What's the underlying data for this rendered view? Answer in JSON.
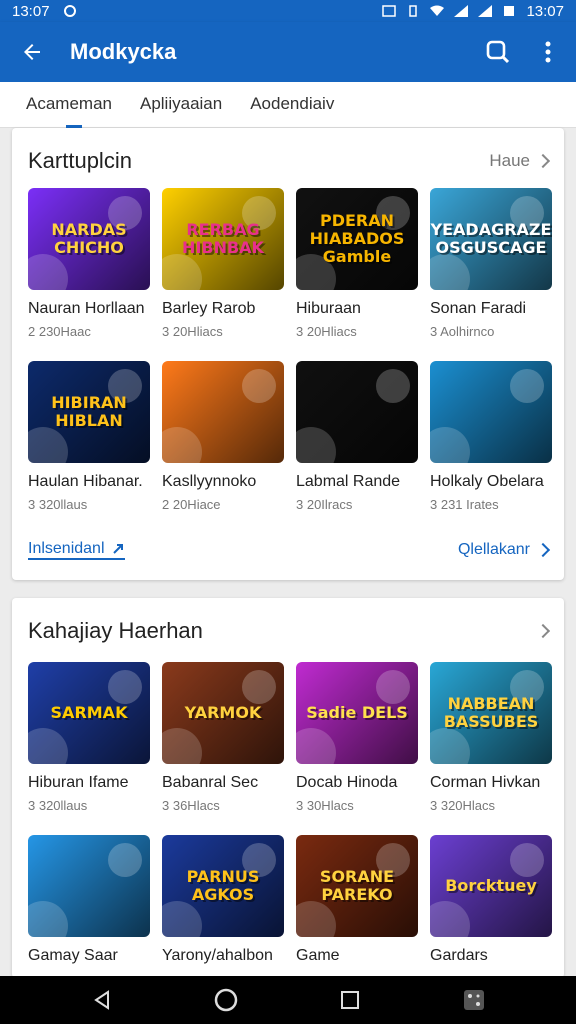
{
  "status": {
    "time_left": "13:07",
    "time_right": "13:07"
  },
  "appbar": {
    "title": "Modkycka",
    "back_icon": "arrow-left-icon",
    "search_icon": "search-icon",
    "menu_icon": "more-vert-icon"
  },
  "tabs": [
    "Acameman",
    "Apliiyaaian",
    "Aodendiaiv"
  ],
  "section1": {
    "title": "Karttuplcin",
    "more": "Haue",
    "items": [
      {
        "name": "Nauran Horllaan",
        "sub": "2 230Haac",
        "art": "NARDAS CHICHO",
        "bg": "#7b2ff7",
        "fg": "#ffd23f"
      },
      {
        "name": "Barley Rarob",
        "sub": "3 20Hliacs",
        "art": "RERBAG HIBNBAK",
        "bg": "#ffd000",
        "fg": "#e8308c"
      },
      {
        "name": "Hiburaan",
        "sub": "3 20Hliacs",
        "art": "PDERAN HIABADOS Gamble",
        "bg": "#111111",
        "fg": "#f7b500"
      },
      {
        "name": "Sonan Faradi",
        "sub": "3 Aolhirnco",
        "art": "YEADAGRAZE OSGUSCAGE",
        "bg": "#3aa6d8",
        "fg": "#ffffff"
      },
      {
        "name": "Haulan Hibanar.",
        "sub": "3 320llaus",
        "art": "HIBIRAN HIBLAN",
        "bg": "#0d2a6b",
        "fg": "#ffc21a"
      },
      {
        "name": "Kasllyynnoko",
        "sub": "2 20Hiace",
        "art": "",
        "bg": "#ff7a1a",
        "fg": "#ffffff"
      },
      {
        "name": "Labmal Rande",
        "sub": "3 20Ilracs",
        "art": "",
        "bg": "#101010",
        "fg": "#ffffff"
      },
      {
        "name": "Holkaly Obelara",
        "sub": "3 231 Irates",
        "art": "",
        "bg": "#1b8fd1",
        "fg": "#ffffff"
      }
    ],
    "footer_left": "Inlsenidanl",
    "footer_right": "Qlellakanr"
  },
  "section2": {
    "title": "Kahajiay Haerhan",
    "items": [
      {
        "name": "Hiburan Ifame",
        "sub": "3 320llaus",
        "art": "SARMAK",
        "bg": "#1f3fa8",
        "fg": "#ffcc00"
      },
      {
        "name": "Babanral Sec",
        "sub": "3 36Hlacs",
        "art": "YARMOK",
        "bg": "#8a3a1c",
        "fg": "#ffd23f"
      },
      {
        "name": "Docab Hinoda",
        "sub": "3 30Hlacs",
        "art": "Sadie DELS",
        "bg": "#c02bd1",
        "fg": "#ffe14d"
      },
      {
        "name": "Corman Hivkan",
        "sub": "3 320Hlacs",
        "art": "NABBEAN BASSUBES",
        "bg": "#29a7d6",
        "fg": "#ffd23f"
      },
      {
        "name": "Gamay Saar",
        "sub": "",
        "art": "",
        "bg": "#2596e6",
        "fg": "#ffffff"
      },
      {
        "name": "Yarony/ahalbon",
        "sub": "",
        "art": "PARNUS AGKOS",
        "bg": "#1b3a9c",
        "fg": "#ffc21a"
      },
      {
        "name": "Game",
        "sub": "",
        "art": "SORANE PAREKO",
        "bg": "#7a2a10",
        "fg": "#ffd23f"
      },
      {
        "name": "Gardars",
        "sub": "",
        "art": "Borcktuey",
        "bg": "#6b3fd1",
        "fg": "#ffd23f"
      }
    ]
  },
  "navbar": {
    "back": "nav-back-icon",
    "home": "nav-home-icon",
    "recents": "nav-recents-icon",
    "extra": "nav-extra-icon"
  }
}
